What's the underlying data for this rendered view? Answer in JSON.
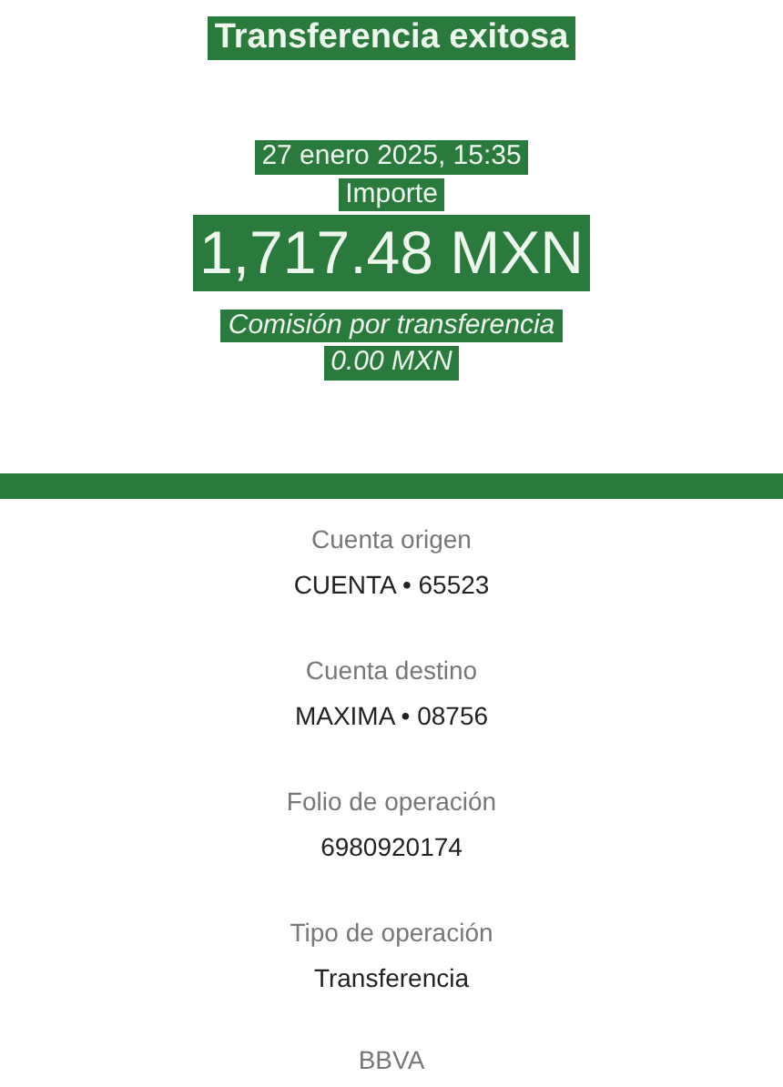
{
  "header": {
    "title": "Transferencia exitosa",
    "date": "27 enero 2025, 15:35",
    "amount_label": "Importe",
    "amount": "1,717.48 MXN",
    "fee_label": "Comisión por transferencia",
    "fee": "0.00 MXN"
  },
  "details": [
    {
      "label": "Cuenta origen",
      "value": "CUENTA • 65523"
    },
    {
      "label": "Cuenta destino",
      "value": "MAXIMA • 08756"
    },
    {
      "label": "Folio de operación",
      "value": "6980920174"
    },
    {
      "label": "Tipo de operación",
      "value": "Transferencia"
    }
  ],
  "bank": "BBVA"
}
